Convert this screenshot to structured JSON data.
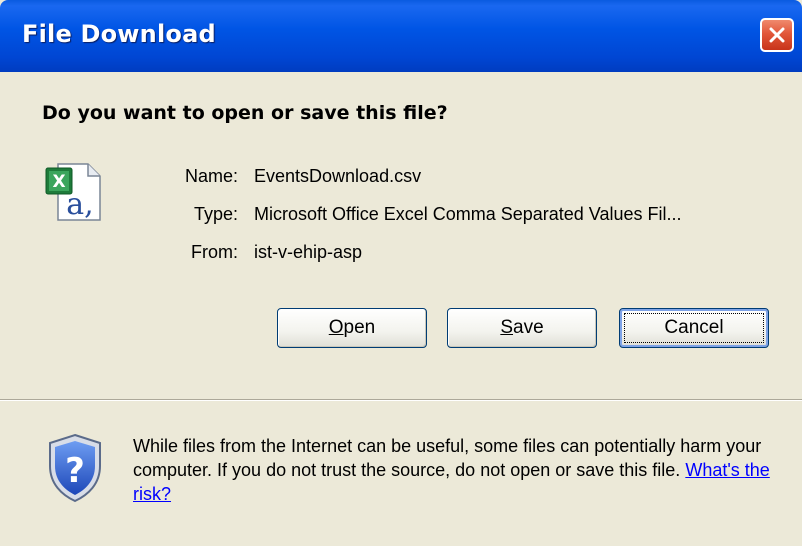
{
  "window": {
    "title": "File Download",
    "close_icon": "close-icon"
  },
  "dialog": {
    "question": "Do you want to open or save this file?",
    "file_icon": "excel-csv-file-icon",
    "fields": [
      {
        "label": "Name:",
        "value": "EventsDownload.csv"
      },
      {
        "label": "Type:",
        "value": "Microsoft Office Excel Comma Separated Values Fil..."
      },
      {
        "label": "From:",
        "value": "ist-v-ehip-asp"
      }
    ],
    "buttons": {
      "open": {
        "mnemonic": "O",
        "rest": "pen"
      },
      "save": {
        "mnemonic": "S",
        "rest": "ave"
      },
      "cancel": {
        "label": "Cancel"
      }
    },
    "warning": {
      "icon": "shield-question-icon",
      "text": "While files from the Internet can be useful, some files can potentially harm your computer. If you do not trust the source, do not open or save this file. ",
      "link": "What's the risk?"
    }
  },
  "colors": {
    "titlebar": "#0055E5",
    "dialog_bg": "#ECE9D8",
    "close_button": "#E2573A",
    "link": "#0000FF"
  }
}
